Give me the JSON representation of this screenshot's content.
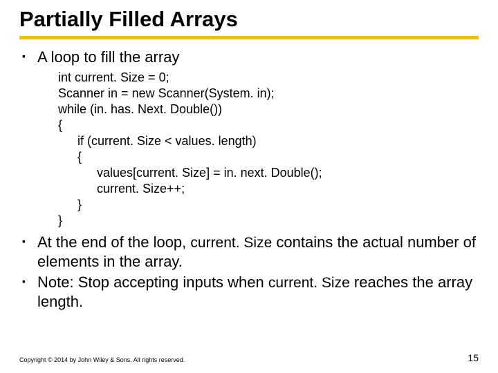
{
  "title": "Partially Filled Arrays",
  "bullets": {
    "b1": "A loop to fill the array",
    "b2_pre": "At the end of the loop, ",
    "b2_code": "current. Size",
    "b2_post": " contains the actual number of elements in the array.",
    "b3_pre": "Note: Stop accepting inputs when ",
    "b3_code": "current. Size",
    "b3_post": " reaches the array length."
  },
  "code": {
    "l1": "int current. Size = 0;",
    "l2": "Scanner in = new Scanner(System. in);",
    "l3": "while (in. has. Next. Double())",
    "l4": "{",
    "l5": "if (current. Size < values. length)",
    "l6": "{",
    "l7": "values[current. Size] = in. next. Double();",
    "l8": "current. Size++;",
    "l9": "}",
    "l10": "}"
  },
  "footer": {
    "copyright": "Copyright © 2014 by John Wiley & Sons. All rights reserved.",
    "page": "15"
  }
}
